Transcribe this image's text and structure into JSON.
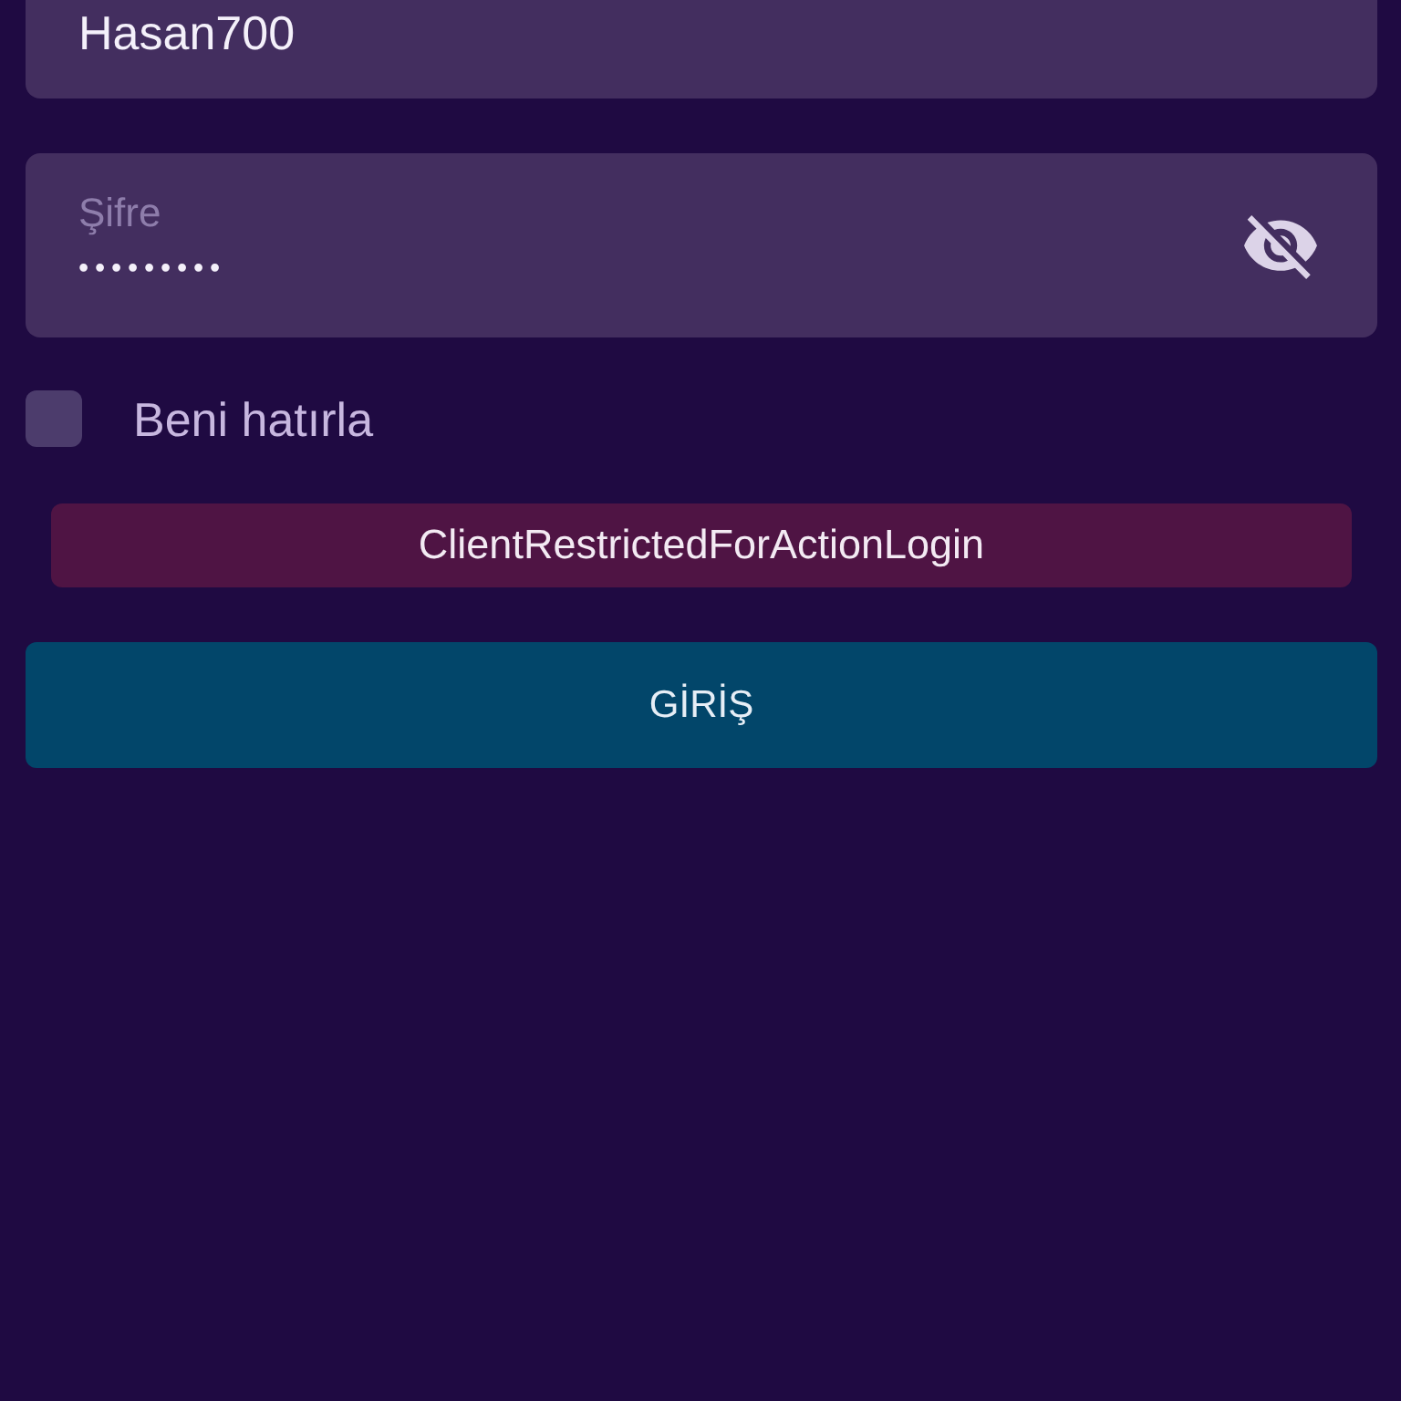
{
  "username_field": {
    "value": "Hasan700"
  },
  "password_field": {
    "label": "Şifre",
    "value": "•••••••••",
    "visible": false
  },
  "remember_me": {
    "label": "Beni hatırla",
    "checked": false
  },
  "error_message": {
    "text": "ClientRestrictedForActionLogin"
  },
  "login_button": {
    "label": "GİRİŞ"
  }
}
